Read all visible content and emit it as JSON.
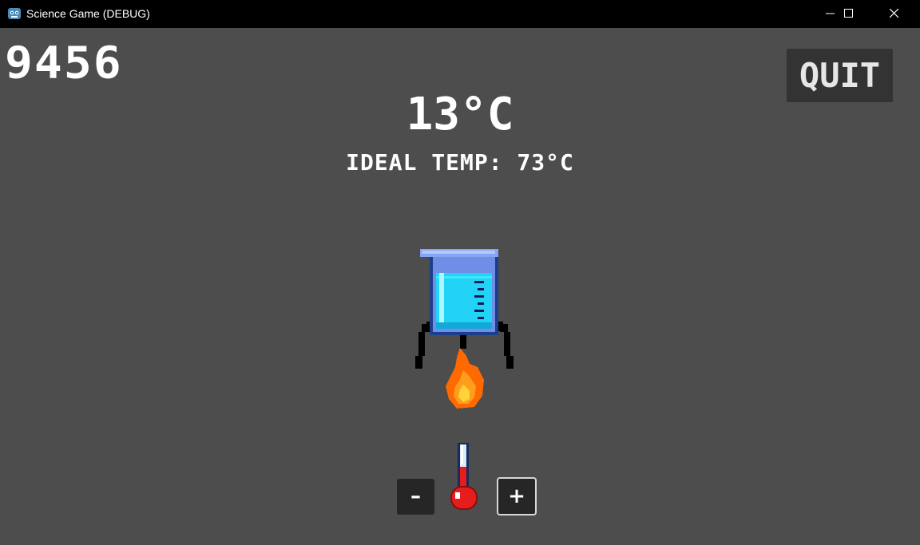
{
  "window": {
    "title": "Science Game (DEBUG)",
    "icon": "godot-icon",
    "controls": [
      "minimize-icon",
      "maximize-icon",
      "close-icon"
    ]
  },
  "hud": {
    "score": "9456",
    "current_temp": "13°C",
    "ideal_temp": "IDEAL TEMP: 73°C",
    "quit_label": "QUIT"
  },
  "controls": {
    "decrease_label": "–",
    "increase_label": "+"
  },
  "colors": {
    "background": "#4d4d4d",
    "titlebar": "#000000",
    "quit_button_bg": "#333333",
    "liquid": "#22d3f5",
    "flame_outer": "#ff6a00",
    "flame_inner": "#ffd23a",
    "thermometer_red": "#e51d1d"
  },
  "icons": {
    "beaker": "beaker-icon",
    "flame": "flame-icon",
    "stand": "tripod-stand-icon",
    "thermometer": "thermometer-icon"
  }
}
